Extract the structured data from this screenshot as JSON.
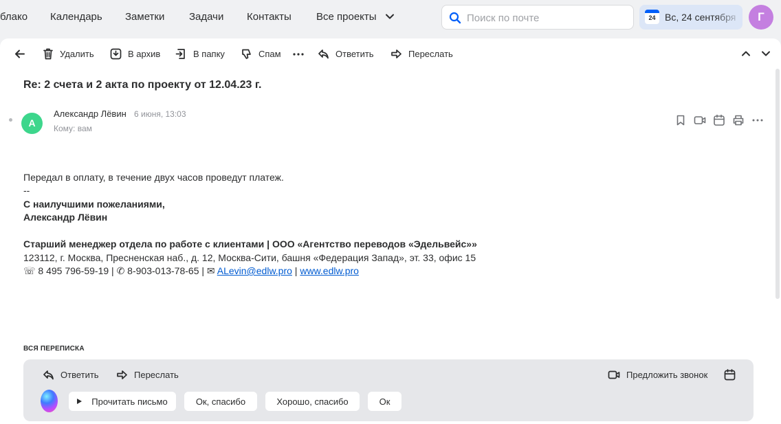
{
  "nav": {
    "items": [
      "блако",
      "Календарь",
      "Заметки",
      "Задачи",
      "Контакты",
      "Все проекты"
    ],
    "search_placeholder": "Поиск по почте",
    "date_badge_day": "24",
    "date_label": "Вс, 24 сентября",
    "user_initial": "Г"
  },
  "toolbar": {
    "delete": "Удалить",
    "archive": "В архив",
    "to_folder": "В папку",
    "spam": "Спам",
    "reply": "Ответить",
    "forward": "Переслать"
  },
  "message": {
    "subject": "Re: 2 счета и 2 акта по проекту от 12.04.23 г.",
    "sender_initial": "А",
    "sender_name": "Александр Лёвин",
    "date": "6 июня, 13:03",
    "recipient": "Кому: вам",
    "body": {
      "line1": "Передал в оплату, в течение двух часов проведут платеж.",
      "separator": "--",
      "regards": "С наилучшими пожеланиями,",
      "signature_name": "Александр Лёвин",
      "title": "Старший менеджер отдела по работе с клиентами | ООО «Агентство переводов «Эдельвейс»»",
      "address": "123112, г. Москва, Пресненская наб., д. 12, Москва-Сити, башня «Федерация Запад», эт. 33, офис 15",
      "contacts_prefix": "☏ 8 495 796-59-19 | ✆ 8-903-013-78-65 | ✉ ",
      "email": "ALevin@edlw.pro",
      "divider": " | ",
      "website": "www.edlw.pro"
    }
  },
  "thread": {
    "label": "ВСЯ ПЕРЕПИСКА",
    "reply": "Ответить",
    "forward": "Переслать",
    "suggest_call": "Предложить звонок",
    "quick_replies": [
      "Прочитать письмо",
      "Ок, спасибо",
      "Хорошо, спасибо",
      "Ок"
    ]
  },
  "colors": {
    "accent": "#005ff9",
    "sender_avatar": "#3dd68c",
    "user_avatar": "#c47fe0",
    "link": "#005bd1"
  }
}
